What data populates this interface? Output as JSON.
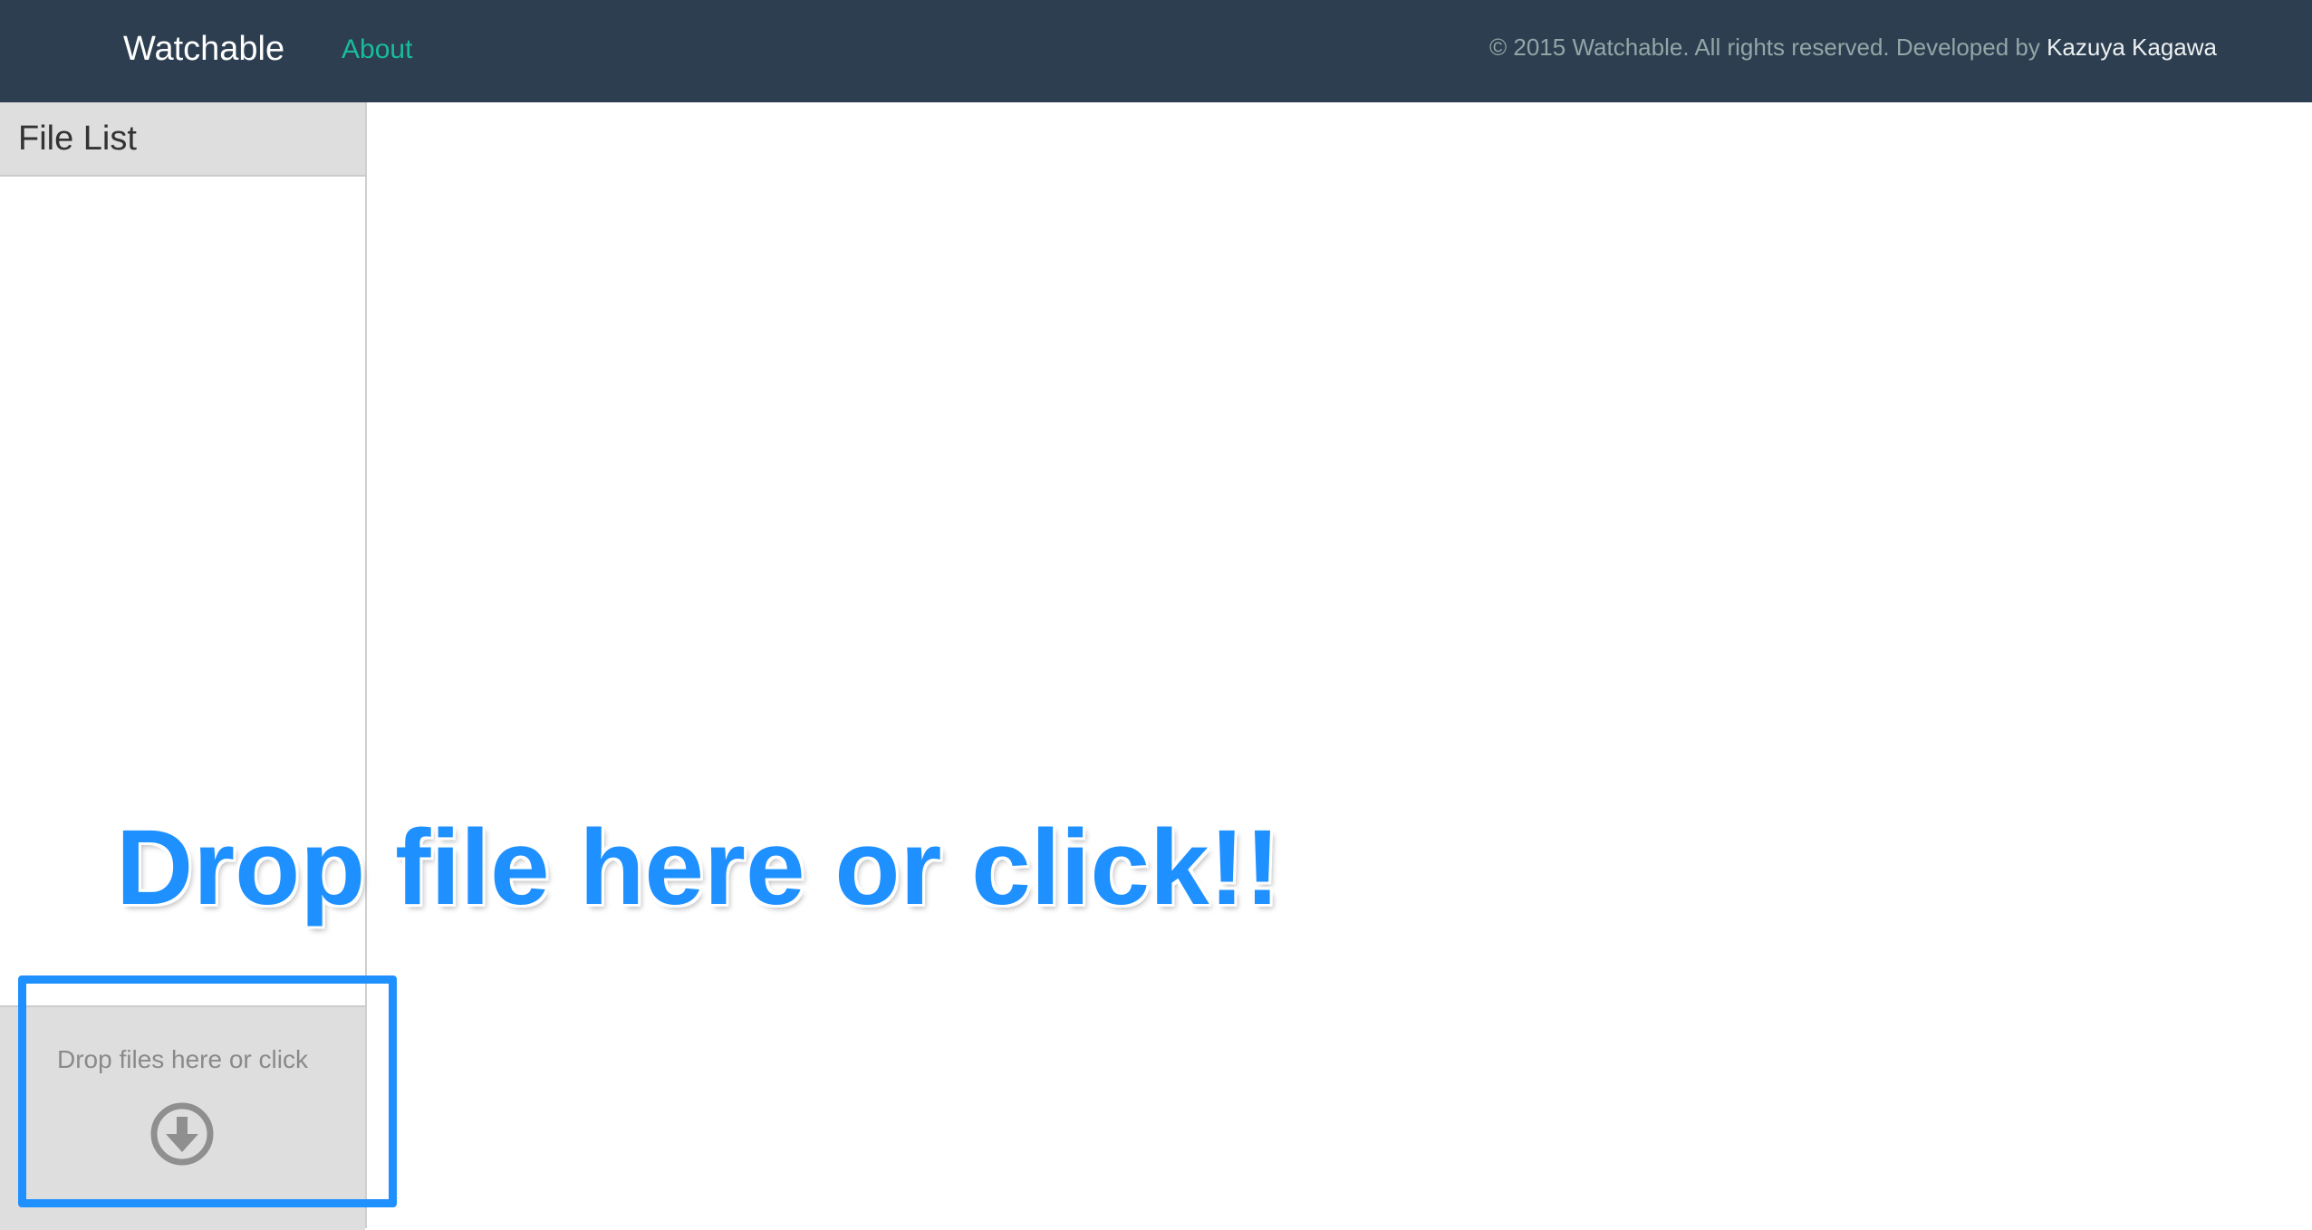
{
  "navbar": {
    "brand": "Watchable",
    "about_label": "About",
    "copyright_prefix": "© 2015 Watchable. All rights reserved. Developed by",
    "author": "Kazuya Kagawa"
  },
  "sidebar": {
    "title": "File List",
    "items": []
  },
  "dropzone": {
    "label": "Drop files here or click",
    "icon": "download-circle-icon"
  },
  "annotation": {
    "callout": "Drop file here or click!!"
  },
  "colors": {
    "navbar_bg": "#2c3e50",
    "accent": "#18bc9c",
    "annotation_blue": "#1e90ff",
    "panel_gray": "#dedede"
  }
}
